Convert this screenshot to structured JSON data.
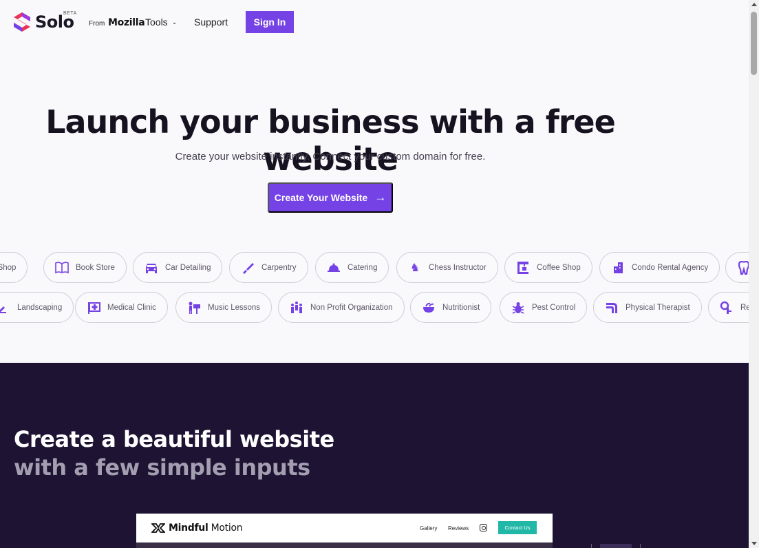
{
  "header": {
    "brand": "Solo",
    "beta": "BETA",
    "from": "From",
    "partner": "Mozilla",
    "nav_tools": "Tools",
    "nav_support": "Support",
    "signin_label": "Sign In"
  },
  "hero": {
    "title": "Launch your business with a free website",
    "subtitle": "Create your website instantly. Connect your custom domain for free.",
    "cta_label": "Create Your Website"
  },
  "categories_row1": [
    {
      "label": "e Shop",
      "icon": "shop-icon"
    },
    {
      "label": "Book Store",
      "icon": "book-icon"
    },
    {
      "label": "Car Detailing",
      "icon": "car-icon"
    },
    {
      "label": "Carpentry",
      "icon": "saw-icon"
    },
    {
      "label": "Catering",
      "icon": "cloche-icon"
    },
    {
      "label": "Chess Instructor",
      "icon": "chess-knight-icon"
    },
    {
      "label": "Coffee Shop",
      "icon": "coffee-machine-icon"
    },
    {
      "label": "Condo Rental Agency",
      "icon": "building-icon"
    },
    {
      "label": "",
      "icon": "tooth-icon"
    }
  ],
  "categories_row2": [
    {
      "label": "Landscaping",
      "icon": "shovel-icon"
    },
    {
      "label": "Medical Clinic",
      "icon": "medical-cross-icon"
    },
    {
      "label": "Music Lessons",
      "icon": "music-stand-icon"
    },
    {
      "label": "Non Profit Organization",
      "icon": "people-icon"
    },
    {
      "label": "Nutritionist",
      "icon": "bowl-icon"
    },
    {
      "label": "Pest Control",
      "icon": "bug-icon"
    },
    {
      "label": "Physical Therapist",
      "icon": "therapy-icon"
    },
    {
      "label": "Re",
      "icon": "key-icon"
    }
  ],
  "feature": {
    "title_line1": "Create a beautiful website",
    "title_line2": "with a few simple inputs"
  },
  "preview_site": {
    "name_bold": "Mindful",
    "name_rest": " Motion",
    "nav_gallery": "Gallery",
    "nav_reviews": "Reviews",
    "contact_label": "Contact Us"
  },
  "colors": {
    "accent": "#7542e5",
    "dark_bg": "#1e1333",
    "teal": "#22b8a7"
  }
}
